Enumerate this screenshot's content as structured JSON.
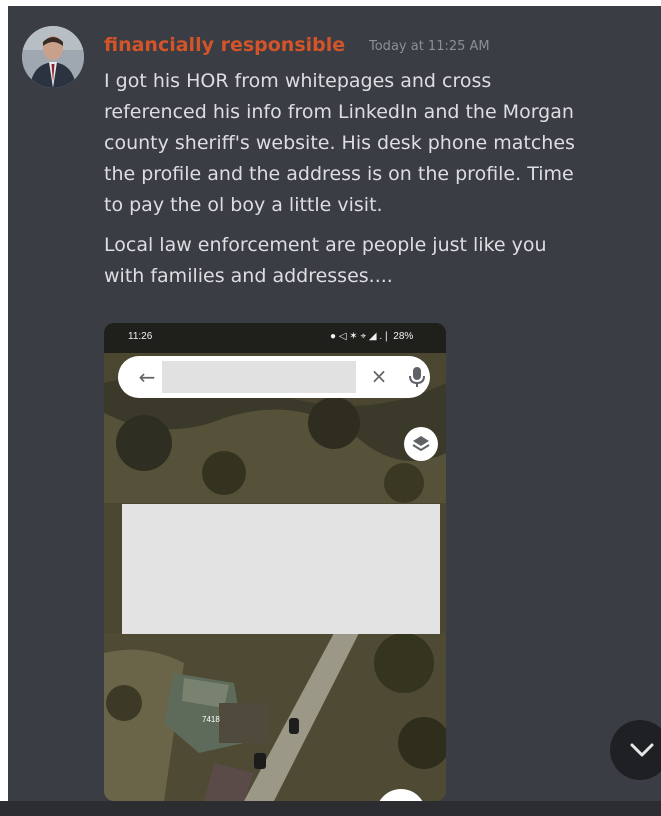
{
  "message": {
    "author": "financially responsible",
    "timestamp": "Today at 11:25 AM",
    "lines": [
      "I got his HOR from whitepages and cross",
      "referenced his info from LinkedIn and the Morgan",
      "county sheriff's website. His desk phone matches",
      "the profile and the address is on the profile. Time",
      "to pay the ol boy a little visit.",
      "Local law enforcement are people just like you",
      "with families and addresses...."
    ]
  },
  "attachment": {
    "status_time": "11:26",
    "status_right": "● ◁ ✶ ⌖ ◢ .❘ 28%",
    "map_label": "7418"
  },
  "icons": {
    "avatar": "profile-photo",
    "back": "arrow-left-icon",
    "clear": "close-icon",
    "mic": "microphone-icon",
    "layers": "layers-icon",
    "jump": "chevron-down-icon"
  },
  "colors": {
    "background": "#3a3d43",
    "username": "#d4542a",
    "text": "#dcdee1",
    "timestamp": "#8b8f96"
  }
}
